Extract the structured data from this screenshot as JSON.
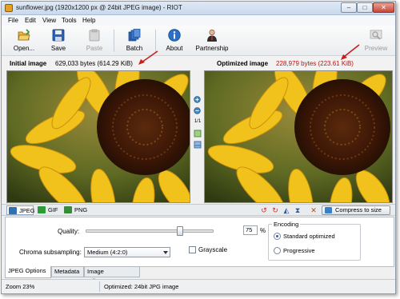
{
  "window": {
    "title": "sunflower.jpg (1920x1200 px @ 24bit JPEG image) - RIOT",
    "minimize_symbol": "–",
    "maximize_symbol": "□",
    "close_symbol": "✕"
  },
  "menu": [
    "File",
    "Edit",
    "View",
    "Tools",
    "Help"
  ],
  "toolbar": {
    "open": "Open...",
    "save": "Save",
    "paste": "Paste",
    "batch": "Batch",
    "about": "About",
    "partnership": "Partnership",
    "preview": "Preview"
  },
  "info": {
    "initial_label": "Initial image",
    "initial_size": "629,033 bytes (614.29 KiB)",
    "optimized_label": "Optimized image",
    "optimized_size": "228,979 bytes (223.61 KiB)"
  },
  "middle_tools": {
    "zoom_ratio": "1/1"
  },
  "formats": {
    "jpeg": "JPEG",
    "gif": "GIF",
    "png": "PNG",
    "compress_to_size": "Compress to size"
  },
  "options": {
    "quality_label": "Quality:",
    "quality_value": "75",
    "quality_percent": 75,
    "quality_unit": "%",
    "chroma_label": "Chroma subsampling:",
    "chroma_value": "Medium (4:2:0)",
    "grayscale_label": "Grayscale",
    "encoding_title": "Encoding",
    "standard_optimized": "Standard optimized",
    "progressive": "Progressive"
  },
  "bottom_tabs": [
    "JPEG Options",
    "Metadata",
    "Image adjustments"
  ],
  "status": {
    "zoom": "Zoom 23%",
    "optimized": "Optimized: 24bit JPG image"
  },
  "colors": {
    "initial_size_text": "#000000",
    "optimized_size_text": "#b3140f",
    "annotation_arrow": "#c81e1e",
    "jpeg_icon": "#2f6fb3",
    "gif_icon": "#2f9a3a",
    "png_icon": "#3b8a3b"
  }
}
